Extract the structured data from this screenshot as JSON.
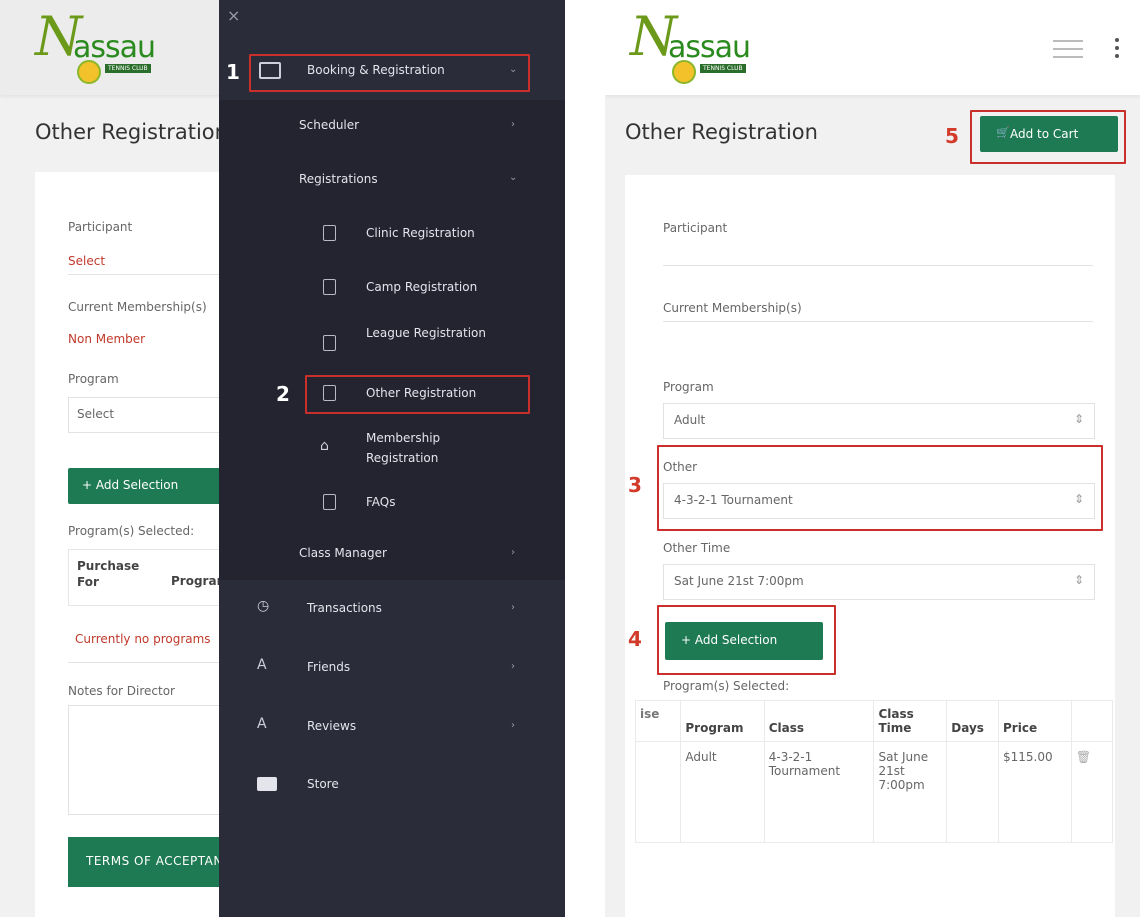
{
  "brand": {
    "logo_letter": "N",
    "logo_word": "assau",
    "logo_sub": "TENNIS CLUB"
  },
  "left": {
    "page_title": "Other Registration",
    "participant_label": "Participant",
    "participant_value": "Select",
    "membership_label": "Current Membership(s)",
    "membership_value": "Non Member",
    "program_label": "Program",
    "program_value": "Select",
    "add_selection": "+ Add Selection",
    "programs_selected_label": "Program(s) Selected:",
    "table_headers": [
      "Purchase For",
      "Program"
    ],
    "empty_message": "Currently no programs",
    "notes_label": "Notes for Director",
    "terms_label": "TERMS OF ACCEPTANCE"
  },
  "sidebar": {
    "close": "×",
    "booking": "Booking & Registration",
    "scheduler": "Scheduler",
    "registrations": "Registrations",
    "items": [
      "Clinic Registration",
      "Camp Registration",
      "League Registration",
      "Other Registration",
      "Membership Registration",
      "FAQs"
    ],
    "class_manager": "Class Manager",
    "transactions": "Transactions",
    "friends": "Friends",
    "reviews": "Reviews",
    "store": "Store"
  },
  "right": {
    "page_title": "Other Registration",
    "add_to_cart": "Add to Cart",
    "participant_label": "Participant",
    "membership_label": "Current Membership(s)",
    "program_label": "Program",
    "program_value": "Adult",
    "other_label": "Other",
    "other_value": "4-3-2-1 Tournament",
    "other_time_label": "Other Time",
    "other_time_value": "Sat June 21st 7:00pm",
    "add_selection": "+ Add Selection",
    "programs_selected_label": "Program(s) Selected:",
    "table": {
      "headers": [
        "ise",
        "Program",
        "Class",
        "Class Time",
        "Days",
        "Price"
      ],
      "row": [
        "",
        "Adult",
        "4-3-2-1 Tournament",
        "Sat June 21st 7:00pm",
        "",
        "$115.00"
      ]
    }
  },
  "steps": [
    "1",
    "2",
    "3",
    "4",
    "5"
  ],
  "colors": {
    "accent_green": "#1d7a52",
    "highlight_red": "#c9302c",
    "sidebar_bg": "#2b2c3a"
  }
}
